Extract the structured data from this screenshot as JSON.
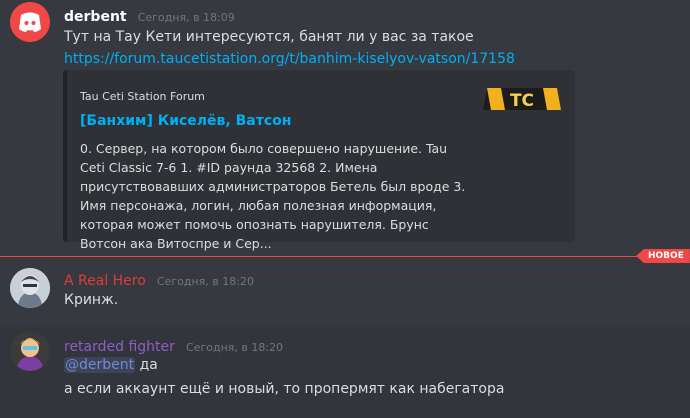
{
  "messages": [
    {
      "author": "derbent",
      "author_color": "#ffffff",
      "timestamp": "Сегодня, в 18:09",
      "text": "Тут на Тау Кети интересуются, банят ли у вас за такое",
      "link": "https://forum.taucetistation.org/t/banhim-kiselyov-vatson/17158",
      "embed": {
        "provider": "Tau Ceti Station Forum",
        "title": "[Банхим] Киселёв, Ватсон",
        "description": "0. Сервер, на котором было совершено нарушение. Tau Ceti Classic 7-6 1. #ID раунда 32568 2. Имена присутствовавших администраторов Бетель был вроде 3. Имя персонажа, логин, любая полезная информация, которая может помочь опознать нарушителя. Брунс Вотсон ака Витоспре и Сер...",
        "thumb_text": "TC"
      }
    },
    {
      "author": "A Real Hero",
      "author_color": "#e03b3b",
      "timestamp": "Сегодня, в 18:20",
      "text": "Кринж."
    },
    {
      "author": "retarded fighter",
      "author_color": "#8e5ec2",
      "timestamp": "Сегодня, в 18:20",
      "mention": "@derbent",
      "text_after_mention": " да",
      "text2": "а если аккаунт ещё и новый, то пропермят как набегатора"
    }
  ],
  "divider": {
    "label": "НОВОЕ",
    "color": "#f04747"
  },
  "colors": {
    "background": "#36393f",
    "link": "#00b0f4",
    "discord_blurple": "#f04747"
  }
}
